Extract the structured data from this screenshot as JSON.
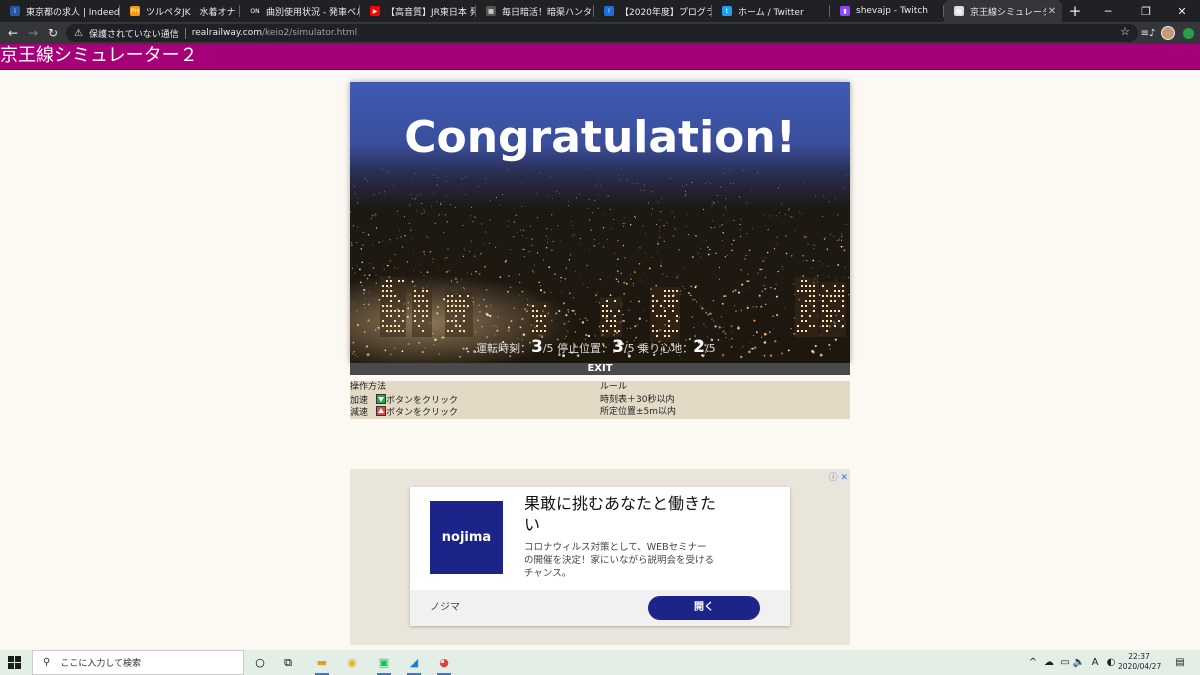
{
  "browser": {
    "tabs": [
      {
        "title": "東京都の求人 | Indeed (イ",
        "favicon_color": "#2557a7",
        "favicon_text": "i"
      },
      {
        "title": "ツルペタJK　水着オナ - P",
        "favicon_color": "#f90",
        "favicon_text": "PH"
      },
      {
        "title": "曲別使用状況 - 発車ベル",
        "favicon_color": "#222",
        "favicon_text": "ON"
      },
      {
        "title": "【高音質】JR東日本 発",
        "favicon_color": "#f00",
        "favicon_text": "▶"
      },
      {
        "title": "毎日暗活！暗渠ハンター",
        "favicon_color": "#555",
        "favicon_text": "▦"
      },
      {
        "title": "【2020年度】プログラミング",
        "favicon_color": "#1e6fd9",
        "favicon_text": "!"
      },
      {
        "title": "ホーム / Twitter",
        "favicon_color": "#1da1f2",
        "favicon_text": "t"
      },
      {
        "title": "shevajp - Twitch",
        "favicon_color": "#9146ff",
        "favicon_text": "▮"
      },
      {
        "title": "京王線シミュレーター２",
        "favicon_color": "#ddd",
        "favicon_text": "▦"
      }
    ],
    "address": {
      "security_label": "保護されていない通信",
      "domain": "realrailway.com",
      "path": "/keio2/simulator.html"
    }
  },
  "page": {
    "title": "京王線シミュレーター２"
  },
  "simulator": {
    "congrats": "Congratulation!",
    "scores": [
      {
        "label": "運転時刻：",
        "score": "3",
        "max": "/5"
      },
      {
        "label": "停止位置：",
        "score": "3",
        "max": "/5"
      },
      {
        "label": "乗り心地：",
        "score": "2",
        "max": "/5"
      }
    ],
    "exit_label": "EXIT"
  },
  "instructions": {
    "header": "操作方法",
    "accelerate_label": "加速",
    "decelerate_label": "減速",
    "button_text": "ボタンをクリック"
  },
  "rules": {
    "header": "ルール",
    "line1": "時刻表＋30秒以内",
    "line2": "所定位置±5m以内"
  },
  "ad": {
    "logo_text": "nojima",
    "headline": "果敢に挑むあなたと働きたい",
    "body": "コロナウィルス対策として、WEBセミナーの開催を決定！家にいながら説明会を受けるチャンス。",
    "advertiser": "ノジマ",
    "cta": "開く",
    "adchoices": "ⓘ ✕"
  },
  "taskbar": {
    "search_placeholder": "ここに入力して検索",
    "time": "22:37",
    "date": "2020/04/27"
  }
}
